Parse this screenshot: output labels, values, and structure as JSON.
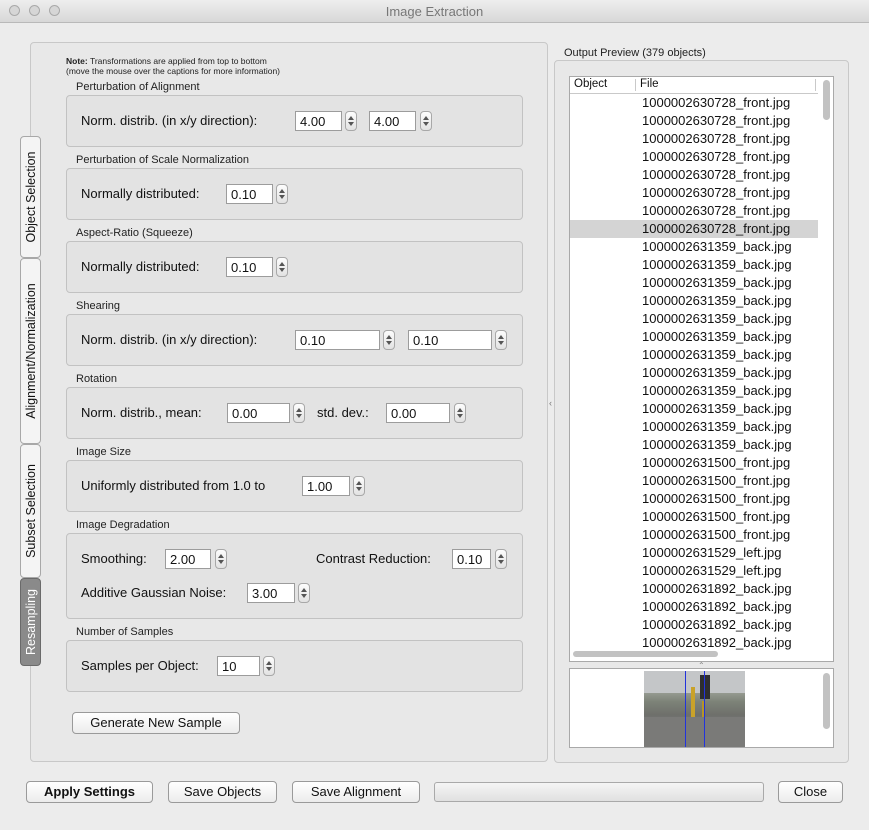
{
  "window": {
    "title": "Image Extraction"
  },
  "tabs": [
    "Object Selection",
    "Alignment/Normalization",
    "Subset Selection",
    "Resampling"
  ],
  "note": {
    "bold": "Note:",
    "line1": " Transformations are applied from top to bottom",
    "line2": "(move the mouse over the captions for more information)"
  },
  "alignment": {
    "title": "Perturbation of Alignment",
    "label": "Norm. distrib. (in x/y direction):",
    "x": "4.00",
    "y": "4.00"
  },
  "scale": {
    "title": "Perturbation of Scale Normalization",
    "label": "Normally distributed:",
    "value": "0.10"
  },
  "aspect": {
    "title": "Aspect-Ratio (Squeeze)",
    "label": "Normally distributed:",
    "value": "0.10"
  },
  "shearing": {
    "title": "Shearing",
    "label": "Norm. distrib. (in x/y direction):",
    "x": "0.10",
    "y": "0.10"
  },
  "rotation": {
    "title": "Rotation",
    "mean_label": "Norm. distrib., mean:",
    "mean": "0.00",
    "std_label": "std. dev.:",
    "std": "0.00"
  },
  "image_size": {
    "title": "Image Size",
    "label": "Uniformly distributed from 1.0 to",
    "value": "1.00"
  },
  "degradation": {
    "title": "Image Degradation",
    "smoothing_label": "Smoothing:",
    "smoothing": "2.00",
    "contrast_label": "Contrast Reduction:",
    "contrast": "0.10",
    "noise_label": "Additive Gaussian Noise:",
    "noise": "3.00"
  },
  "samples": {
    "title": "Number of Samples",
    "label": "Samples per Object:",
    "value": "10"
  },
  "buttons": {
    "generate": "Generate New Sample",
    "apply": "Apply Settings",
    "save_objects": "Save Objects",
    "save_alignment": "Save Alignment",
    "close": "Close"
  },
  "output": {
    "title": "Output Preview (379 objects)",
    "col_object": "Object",
    "col_file": "File",
    "selected_index": 7,
    "files": [
      "1000002630728_front.jpg",
      "1000002630728_front.jpg",
      "1000002630728_front.jpg",
      "1000002630728_front.jpg",
      "1000002630728_front.jpg",
      "1000002630728_front.jpg",
      "1000002630728_front.jpg",
      "1000002630728_front.jpg",
      "1000002631359_back.jpg",
      "1000002631359_back.jpg",
      "1000002631359_back.jpg",
      "1000002631359_back.jpg",
      "1000002631359_back.jpg",
      "1000002631359_back.jpg",
      "1000002631359_back.jpg",
      "1000002631359_back.jpg",
      "1000002631359_back.jpg",
      "1000002631359_back.jpg",
      "1000002631359_back.jpg",
      "1000002631359_back.jpg",
      "1000002631500_front.jpg",
      "1000002631500_front.jpg",
      "1000002631500_front.jpg",
      "1000002631500_front.jpg",
      "1000002631500_front.jpg",
      "1000002631529_left.jpg",
      "1000002631529_left.jpg",
      "1000002631892_back.jpg",
      "1000002631892_back.jpg",
      "1000002631892_back.jpg",
      "1000002631892_back.jpg"
    ]
  }
}
